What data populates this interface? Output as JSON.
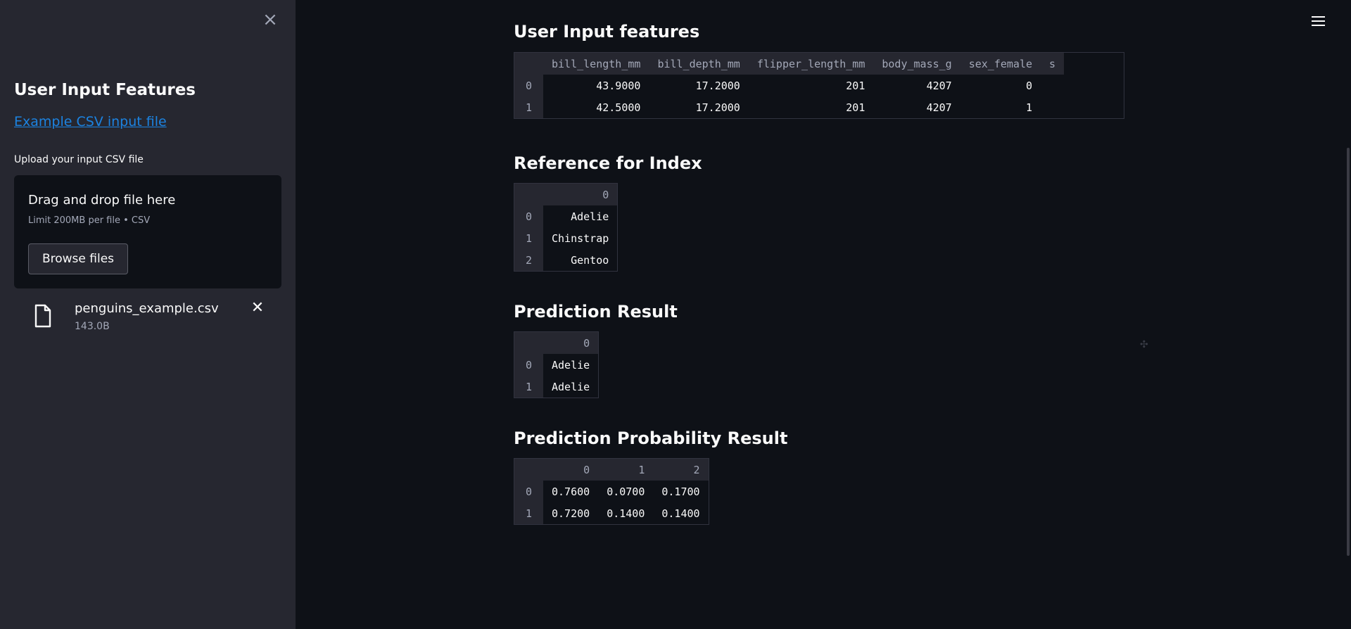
{
  "sidebar": {
    "close_icon": "close-icon",
    "title": "User Input Features",
    "example_link": "Example CSV input file",
    "upload_label": "Upload your input CSV file",
    "dropzone": {
      "title": "Drag and drop file here",
      "subtitle": "Limit 200MB per file • CSV",
      "browse_label": "Browse files"
    },
    "file": {
      "name": "penguins_example.csv",
      "size": "143.0B"
    }
  },
  "main": {
    "sections": [
      {
        "title": "User Input features",
        "columns": [
          "bill_length_mm",
          "bill_depth_mm",
          "flipper_length_mm",
          "body_mass_g",
          "sex_female",
          "s"
        ],
        "rows": [
          {
            "index": "0",
            "cells": [
              "43.9000",
              "17.2000",
              "201",
              "4207",
              "0",
              ""
            ]
          },
          {
            "index": "1",
            "cells": [
              "42.5000",
              "17.2000",
              "201",
              "4207",
              "1",
              ""
            ]
          }
        ]
      },
      {
        "title": "Reference for Index",
        "columns": [
          "0"
        ],
        "rows": [
          {
            "index": "0",
            "cells": [
              "Adelie"
            ]
          },
          {
            "index": "1",
            "cells": [
              "Chinstrap"
            ]
          },
          {
            "index": "2",
            "cells": [
              "Gentoo"
            ]
          }
        ]
      },
      {
        "title": "Prediction Result",
        "columns": [
          "0"
        ],
        "rows": [
          {
            "index": "0",
            "cells": [
              "Adelie"
            ]
          },
          {
            "index": "1",
            "cells": [
              "Adelie"
            ]
          }
        ]
      },
      {
        "title": "Prediction Probability Result",
        "columns": [
          "0",
          "1",
          "2"
        ],
        "rows": [
          {
            "index": "0",
            "cells": [
              "0.7600",
              "0.0700",
              "0.1700"
            ]
          },
          {
            "index": "1",
            "cells": [
              "0.7200",
              "0.1400",
              "0.1400"
            ]
          }
        ]
      }
    ]
  },
  "colors": {
    "background": "#0e1117",
    "sidebar": "#262730",
    "link": "#1c83e1",
    "table_header": "#262730"
  }
}
